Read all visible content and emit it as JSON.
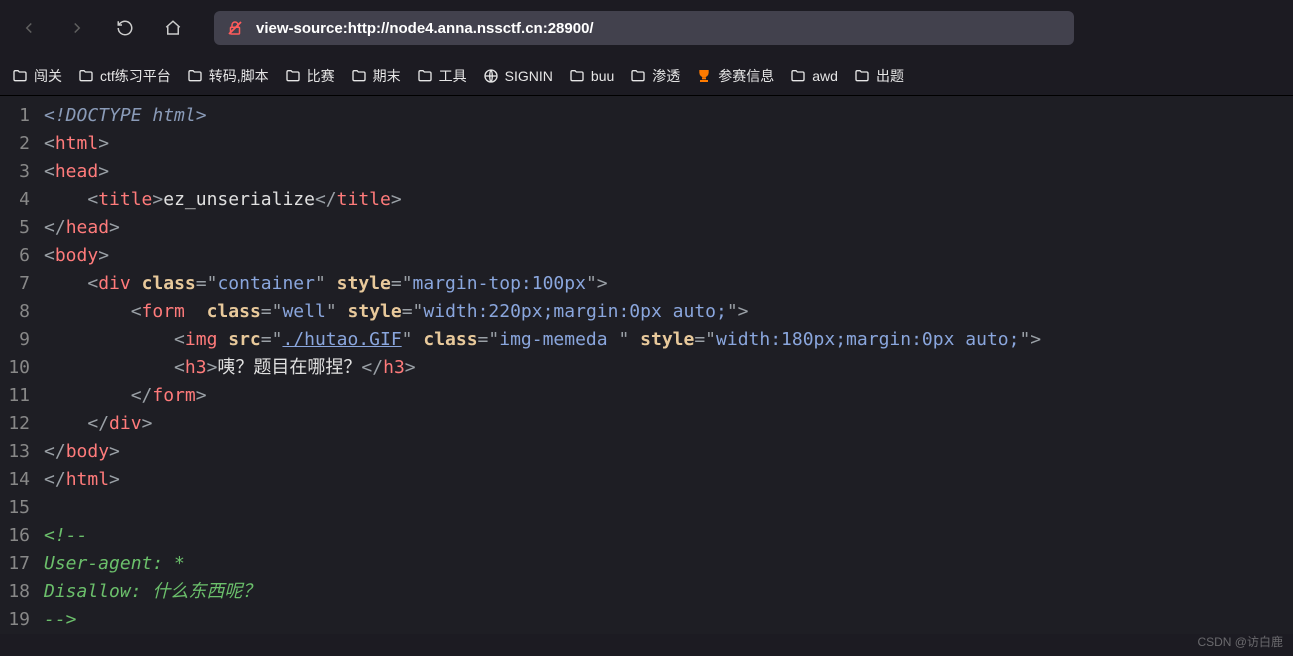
{
  "toolbar": {
    "url": "view-source:http://node4.anna.nssctf.cn:28900/"
  },
  "bookmarks": [
    {
      "type": "folder",
      "label": "闯关"
    },
    {
      "type": "folder",
      "label": "ctf练习平台"
    },
    {
      "type": "folder",
      "label": "转码,脚本"
    },
    {
      "type": "folder",
      "label": "比赛"
    },
    {
      "type": "folder",
      "label": "期末"
    },
    {
      "type": "folder",
      "label": "工具"
    },
    {
      "type": "globe",
      "label": "SIGNIN"
    },
    {
      "type": "folder",
      "label": "buu"
    },
    {
      "type": "folder",
      "label": "渗透"
    },
    {
      "type": "cup",
      "label": "参赛信息"
    },
    {
      "type": "folder",
      "label": "awd"
    },
    {
      "type": "folder",
      "label": "出题"
    }
  ],
  "source": {
    "l1": "<!DOCTYPE html>",
    "l3_title": "ez_unserialize",
    "l7_class": "container",
    "l7_style": "margin-top:100px",
    "l8_class": "well",
    "l8_style": "width:220px;margin:0px auto;",
    "l9_src": "./hutao.GIF",
    "l9_class": "img-memeda ",
    "l9_style": "width:180px;margin:0px auto;",
    "l10_text": "咦？题目在哪捏？",
    "l17": "User-agent: *",
    "l18": "Disallow: 什么东西呢？"
  },
  "watermark": "CSDN @访白鹿"
}
